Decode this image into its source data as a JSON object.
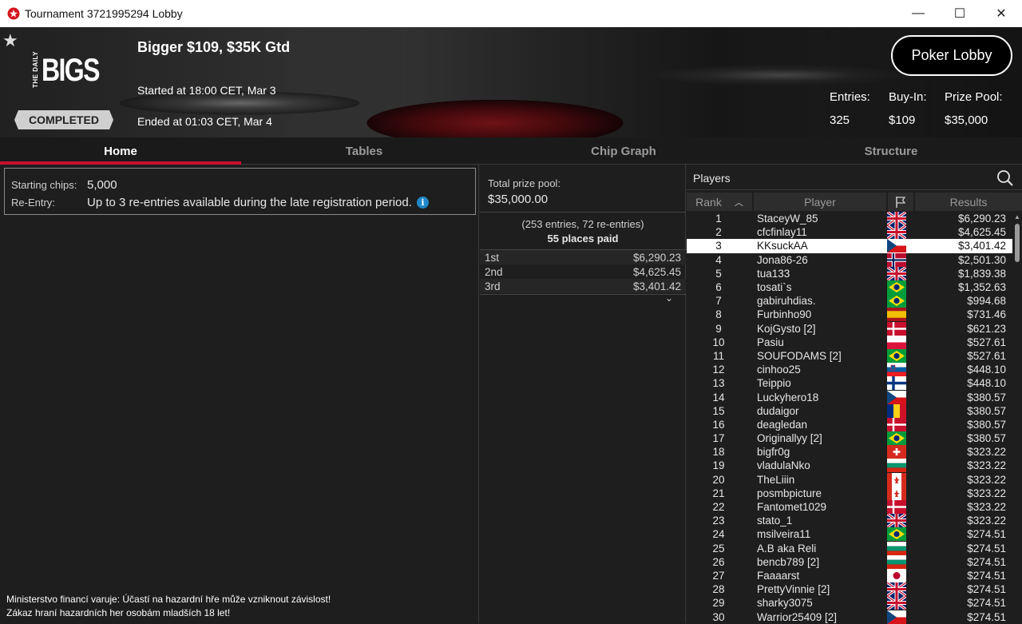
{
  "window": {
    "title": "Tournament 3721995294 Lobby",
    "minimize": "—",
    "maximize": "☐",
    "close": "✕"
  },
  "banner": {
    "logo_small": "THE DAILY",
    "logo_big": "BIGS",
    "status": "COMPLETED",
    "name": "Bigger $109, $35K Gtd",
    "started": "Started at 18:00 CET, Mar 3",
    "ended": "Ended at 01:03 CET, Mar 4",
    "lobby_button": "Poker Lobby",
    "entries_label": "Entries:",
    "entries_value": "325",
    "buyin_label": "Buy-In:",
    "buyin_value": "$109",
    "pool_label": "Prize Pool:",
    "pool_value": "$35,000"
  },
  "tabs": [
    "Home",
    "Tables",
    "Chip Graph",
    "Structure"
  ],
  "info": {
    "chips_label": "Starting chips:",
    "chips_value": "5,000",
    "reentry_label": "Re-Entry:",
    "reentry_value": "Up to 3 re-entries available during the late registration period.",
    "info_icon": "i"
  },
  "disclaimer": {
    "line1": "Ministerstvo financí varuje: Účastí na hazardní hře může vzniknout závislost!",
    "line2": "Zákaz hraní hazardních her osobám mladších 18 let!"
  },
  "prize": {
    "pool_label": "Total prize pool:",
    "pool_value": "$35,000.00",
    "entries_line": "(253 entries, 72 re-entries)",
    "places_line": "55 places paid",
    "payouts": [
      {
        "place": "1st",
        "amount": "$6,290.23"
      },
      {
        "place": "2nd",
        "amount": "$4,625.45"
      },
      {
        "place": "3rd",
        "amount": "$3,401.42"
      }
    ],
    "expand_icon": "⌄"
  },
  "players": {
    "label": "Players",
    "col_rank": "Rank",
    "col_player": "Player",
    "col_results": "Results",
    "rows": [
      {
        "rank": "1",
        "name": "StaceyW_85",
        "flag": "gb",
        "result": "$6,290.23"
      },
      {
        "rank": "2",
        "name": "cfcfinlay11",
        "flag": "gb",
        "result": "$4,625.45"
      },
      {
        "rank": "3",
        "name": "KKsuckAA",
        "flag": "cz",
        "result": "$3,401.42"
      },
      {
        "rank": "4",
        "name": "Jona86-26",
        "flag": "no",
        "result": "$2,501.30"
      },
      {
        "rank": "5",
        "name": "tua133",
        "flag": "gb",
        "result": "$1,839.38"
      },
      {
        "rank": "6",
        "name": "tosati`s",
        "flag": "br",
        "result": "$1,352.63"
      },
      {
        "rank": "7",
        "name": "gabiruhdias.",
        "flag": "br",
        "result": "$994.68"
      },
      {
        "rank": "8",
        "name": "Furbinho90",
        "flag": "es",
        "result": "$731.46"
      },
      {
        "rank": "9",
        "name": "KojGysto [2]",
        "flag": "dk",
        "result": "$621.23"
      },
      {
        "rank": "10",
        "name": "Pasiu",
        "flag": "pl",
        "result": "$527.61"
      },
      {
        "rank": "11",
        "name": "SOUFODAMS [2]",
        "flag": "br",
        "result": "$527.61"
      },
      {
        "rank": "12",
        "name": "cinhoo25",
        "flag": "si",
        "result": "$448.10"
      },
      {
        "rank": "13",
        "name": "Teippio",
        "flag": "fi",
        "result": "$448.10"
      },
      {
        "rank": "14",
        "name": "Luckyhero18",
        "flag": "cz",
        "result": "$380.57"
      },
      {
        "rank": "15",
        "name": "dudaigor",
        "flag": "ro",
        "result": "$380.57"
      },
      {
        "rank": "16",
        "name": "deagledan",
        "flag": "dk",
        "result": "$380.57"
      },
      {
        "rank": "17",
        "name": "Originallyy [2]",
        "flag": "br",
        "result": "$380.57"
      },
      {
        "rank": "18",
        "name": "bigfr0g",
        "flag": "ch",
        "result": "$323.22"
      },
      {
        "rank": "19",
        "name": "vladulaNko",
        "flag": "bg",
        "result": "$323.22"
      },
      {
        "rank": "20",
        "name": "TheLiiin",
        "flag": "ca",
        "result": "$323.22"
      },
      {
        "rank": "21",
        "name": "posmbpicture",
        "flag": "ca",
        "result": "$323.22"
      },
      {
        "rank": "22",
        "name": "Fantomet1029",
        "flag": "dk",
        "result": "$323.22"
      },
      {
        "rank": "23",
        "name": "stato_1",
        "flag": "gb",
        "result": "$323.22"
      },
      {
        "rank": "24",
        "name": "msilveira11",
        "flag": "br",
        "result": "$274.51"
      },
      {
        "rank": "25",
        "name": "A.B aka Reli",
        "flag": "bg",
        "result": "$274.51"
      },
      {
        "rank": "26",
        "name": "bencb789 [2]",
        "flag": "bg",
        "result": "$274.51"
      },
      {
        "rank": "27",
        "name": "Faaaarst",
        "flag": "jp",
        "result": "$274.51"
      },
      {
        "rank": "28",
        "name": "PrettyVinnie [2]",
        "flag": "gb",
        "result": "$274.51"
      },
      {
        "rank": "29",
        "name": "sharky3075",
        "flag": "gb",
        "result": "$274.51"
      },
      {
        "rank": "30",
        "name": "Warrior25409 [2]",
        "flag": "cz",
        "result": "$274.51"
      }
    ],
    "selected_rank": "3"
  },
  "colors": {
    "accent_red": "#c8102e",
    "info_blue": "#1e88c8",
    "background": "#1e1e1e"
  }
}
